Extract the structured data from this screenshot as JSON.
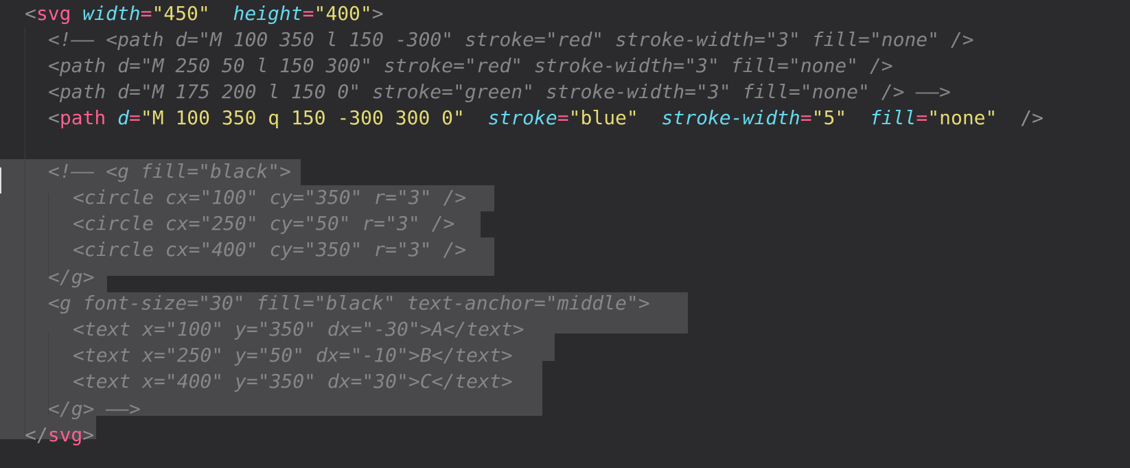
{
  "lines": [
    {
      "indent": 1,
      "kind": "code",
      "tokens": [
        {
          "t": "<",
          "c": "tag-punc"
        },
        {
          "t": "svg",
          "c": "tag-name"
        },
        {
          "t": " ",
          "c": ""
        },
        {
          "t": "width",
          "c": "attr"
        },
        {
          "t": "=",
          "c": "eq"
        },
        {
          "t": "\"450\"",
          "c": "str"
        },
        {
          "t": "  ",
          "c": ""
        },
        {
          "t": "height",
          "c": "attr"
        },
        {
          "t": "=",
          "c": "eq"
        },
        {
          "t": "\"400\"",
          "c": "str"
        },
        {
          "t": ">",
          "c": "tag-punc"
        }
      ]
    },
    {
      "indent": 2,
      "kind": "comment",
      "text": "<!—— <path d=\"M 100 350 l 150 -300\" stroke=\"red\" stroke-width=\"3\" fill=\"none\" />"
    },
    {
      "indent": 2,
      "kind": "comment",
      "text": "<path d=\"M 250 50 l 150 300\" stroke=\"red\" stroke-width=\"3\" fill=\"none\" />"
    },
    {
      "indent": 2,
      "kind": "comment",
      "text": "<path d=\"M 175 200 l 150 0\" stroke=\"green\" stroke-width=\"3\" fill=\"none\" /> ——>"
    },
    {
      "indent": 2,
      "kind": "code",
      "tokens": [
        {
          "t": "<",
          "c": "tag-punc"
        },
        {
          "t": "path",
          "c": "tag-name"
        },
        {
          "t": " ",
          "c": ""
        },
        {
          "t": "d",
          "c": "attr"
        },
        {
          "t": "=",
          "c": "eq"
        },
        {
          "t": "\"M 100 350 q 150 -300 300 0\"",
          "c": "str"
        },
        {
          "t": "  ",
          "c": ""
        },
        {
          "t": "stroke",
          "c": "attr"
        },
        {
          "t": "=",
          "c": "eq"
        },
        {
          "t": "\"blue\"",
          "c": "str"
        },
        {
          "t": "  ",
          "c": ""
        },
        {
          "t": "stroke-width",
          "c": "attr"
        },
        {
          "t": "=",
          "c": "eq"
        },
        {
          "t": "\"5\"",
          "c": "str"
        },
        {
          "t": "  ",
          "c": ""
        },
        {
          "t": "fill",
          "c": "attr"
        },
        {
          "t": "=",
          "c": "eq"
        },
        {
          "t": "\"none\"",
          "c": "str"
        },
        {
          "t": "  ",
          "c": ""
        },
        {
          "t": "/>",
          "c": "tag-punc"
        }
      ]
    },
    {
      "indent": 2,
      "kind": "blank",
      "text": ""
    },
    {
      "indent": 2,
      "kind": "comment",
      "text": "<!—— <g fill=\"black\">"
    },
    {
      "indent": 3,
      "kind": "comment",
      "text": "<circle cx=\"100\" cy=\"350\" r=\"3\" />"
    },
    {
      "indent": 3,
      "kind": "comment",
      "text": "<circle cx=\"250\" cy=\"50\" r=\"3\" />"
    },
    {
      "indent": 3,
      "kind": "comment",
      "text": "<circle cx=\"400\" cy=\"350\" r=\"3\" />"
    },
    {
      "indent": 2,
      "kind": "comment",
      "text": "</g>"
    },
    {
      "indent": 2,
      "kind": "comment",
      "text": "<g font-size=\"30\" fill=\"black\" text-anchor=\"middle\">"
    },
    {
      "indent": 3,
      "kind": "comment",
      "text": "<text x=\"100\" y=\"350\" dx=\"-30\">A</text>"
    },
    {
      "indent": 3,
      "kind": "comment",
      "text": "<text x=\"250\" y=\"50\" dx=\"-10\">B</text>"
    },
    {
      "indent": 3,
      "kind": "comment",
      "text": "<text x=\"400\" y=\"350\" dx=\"30\">C</text>"
    },
    {
      "indent": 2,
      "kind": "comment",
      "text": "</g> ——>"
    },
    {
      "indent": 1,
      "kind": "code",
      "tokens": [
        {
          "t": "</",
          "c": "tag-punc"
        },
        {
          "t": "svg",
          "c": "tag-name"
        },
        {
          "t": ">",
          "c": "tag-punc"
        }
      ]
    }
  ],
  "colors": {
    "background": "#2b2b2d",
    "selection": "#49494b",
    "tag": "#ff5f8f",
    "attribute": "#66d9ef",
    "string": "#e6db74",
    "comment": "#86868a"
  }
}
